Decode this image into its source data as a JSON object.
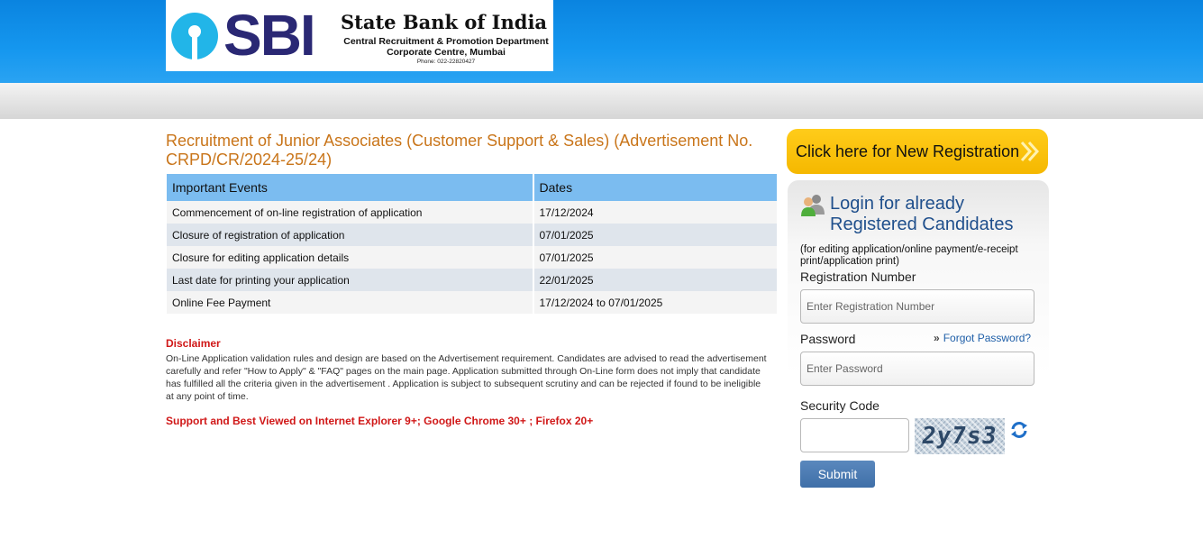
{
  "header": {
    "logo_text": "SBI",
    "bank_name": "State Bank of India",
    "department_line1": "Central Recruitment & Promotion Department",
    "department_line2": "Corporate Centre, Mumbai",
    "phone": "Phone: 022-22820427"
  },
  "main": {
    "title": "Recruitment of Junior Associates (Customer Support & Sales) (Advertisement No. CRPD/CR/2024-25/24)",
    "table": {
      "headers": [
        "Important Events",
        "Dates"
      ],
      "rows": [
        [
          "Commencement of on-line registration of application",
          "17/12/2024"
        ],
        [
          "Closure of registration of application",
          "07/01/2025"
        ],
        [
          "Closure for editing application details",
          "07/01/2025"
        ],
        [
          "Last date for printing your application",
          "22/01/2025"
        ],
        [
          "Online Fee Payment",
          "17/12/2024 to 07/01/2025"
        ]
      ]
    },
    "disclaimer_title": "Disclaimer",
    "disclaimer_text": "On-Line Application validation rules and design are based on the Advertisement requirement. Candidates are advised to read the advertisement carefully and refer \"How to Apply\" & \"FAQ\" pages on the main page. Application submitted through On-Line form does not imply that candidate has fulfilled all the criteria given in the advertisement . Application is subject to subsequent scrutiny and can be rejected if found to be ineligible at any point of time.",
    "support_text": "Support and Best Viewed on Internet Explorer 9+; Google Chrome 30+ ; Firefox 20+"
  },
  "sidebar": {
    "new_registration_label": "Click here for New Registration",
    "login_title_line1": "Login for already",
    "login_title_line2": "Registered Candidates",
    "login_subtitle": "(for editing application/online payment/e-receipt print/application print)",
    "registration_label": "Registration Number",
    "registration_placeholder": "Enter Registration Number",
    "password_label": "Password",
    "password_placeholder": "Enter Password",
    "forgot_password": "Forgot Password?",
    "security_code_label": "Security Code",
    "captcha_text": "2y7s3",
    "submit_label": "Submit"
  },
  "colors": {
    "header_blue": "#1597ef",
    "title_orange": "#c9751a",
    "table_header": "#7bbcf0",
    "alert_red": "#d01818",
    "button_yellow": "#ffcc1a",
    "submit_blue": "#4a7ab2"
  },
  "icons": {
    "users": "users-icon",
    "chevron": "double-chevron-right-icon",
    "refresh": "refresh-icon",
    "forgot_arrow": "double-chevron-icon"
  }
}
